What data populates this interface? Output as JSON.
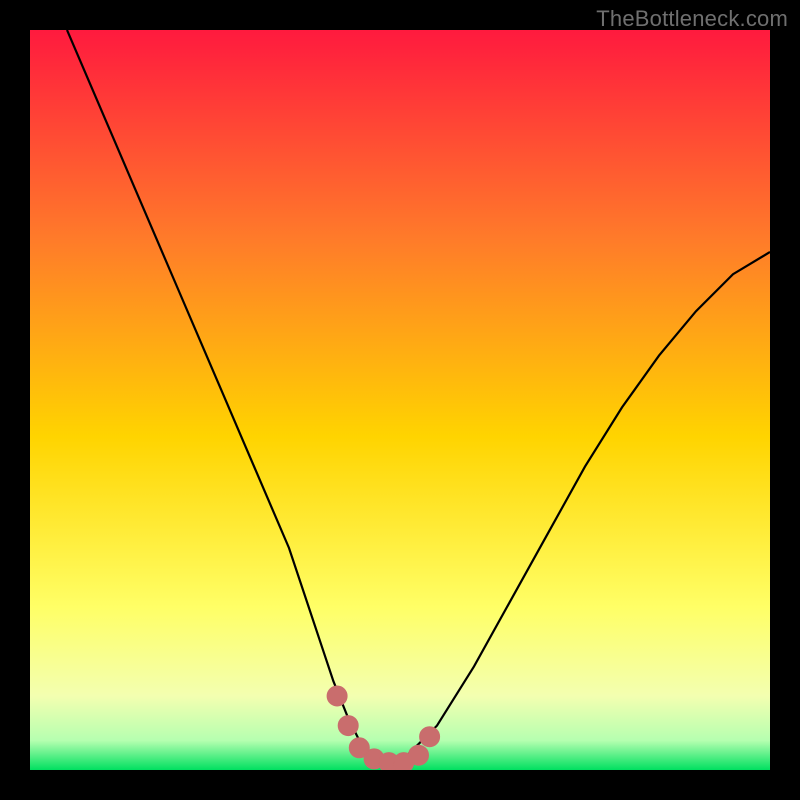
{
  "watermark": "TheBottleneck.com",
  "colors": {
    "background": "#000000",
    "gradient_top": "#ff1a3e",
    "gradient_mid_upper": "#ff7a2a",
    "gradient_mid": "#ffd400",
    "gradient_mid_lower": "#ffff66",
    "gradient_lower": "#f3ffb0",
    "gradient_bottom": "#00e060",
    "curve": "#000000",
    "marker_fill": "#c96d6d",
    "marker_stroke": "#c96d6d"
  },
  "chart_data": {
    "type": "line",
    "title": "",
    "xlabel": "",
    "ylabel": "",
    "xlim": [
      0,
      100
    ],
    "ylim": [
      0,
      100
    ],
    "series": [
      {
        "name": "bottleneck-curve",
        "x": [
          5,
          8,
          11,
          14,
          17,
          20,
          23,
          26,
          29,
          32,
          35,
          37,
          39,
          41,
          43,
          45,
          47,
          49,
          51,
          55,
          60,
          65,
          70,
          75,
          80,
          85,
          90,
          95,
          100
        ],
        "y": [
          100,
          93,
          86,
          79,
          72,
          65,
          58,
          51,
          44,
          37,
          30,
          24,
          18,
          12,
          7,
          3,
          1,
          1,
          2,
          6,
          14,
          23,
          32,
          41,
          49,
          56,
          62,
          67,
          70
        ]
      }
    ],
    "markers": {
      "name": "optimal-range-markers",
      "points": [
        {
          "x": 41.5,
          "y": 10
        },
        {
          "x": 43,
          "y": 6
        },
        {
          "x": 44.5,
          "y": 3
        },
        {
          "x": 46.5,
          "y": 1.5
        },
        {
          "x": 48.5,
          "y": 1
        },
        {
          "x": 50.5,
          "y": 1
        },
        {
          "x": 52.5,
          "y": 2
        },
        {
          "x": 54,
          "y": 4.5
        }
      ]
    }
  }
}
